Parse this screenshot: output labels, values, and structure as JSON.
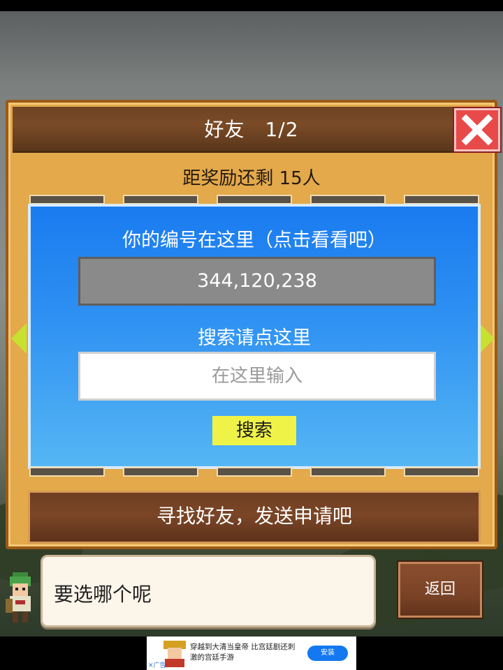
{
  "dialog": {
    "title": "好友　1/2",
    "reward": "距奖励还剩 15人",
    "id_prompt": "你的编号在这里（点击看看吧）",
    "player_id": "344,120,238",
    "search_prompt": "搜索请点这里",
    "search_placeholder": "在这里输入",
    "search_button": "搜索",
    "find_friends": "寻找好友，发送申请吧"
  },
  "message": {
    "text": "要选哪个呢",
    "back_label": "返回"
  },
  "ad": {
    "text": "穿越到大清当皇帝 比宫廷剧还刺激的宫廷手游",
    "install_label": "安装",
    "ad_label": "✕广告"
  },
  "icons": {
    "close": "close-icon",
    "left_arrow": "arrow-left-icon",
    "right_arrow": "arrow-right-icon"
  },
  "colors": {
    "frame": "#e3a94a",
    "panel": "#2d8ff2",
    "close": "#e84a4a",
    "search_button": "#f0f347",
    "arrow": "#c8e030"
  }
}
